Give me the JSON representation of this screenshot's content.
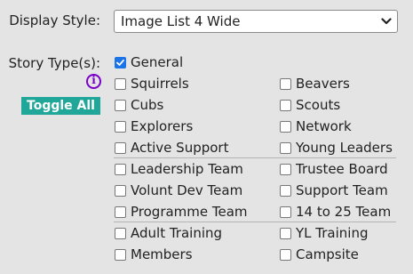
{
  "display_style": {
    "label": "Display Style:",
    "selected": "Image List 4 Wide"
  },
  "story_types": {
    "label": "Story Type(s):",
    "toggle_label": "Toggle All",
    "info_glyph": "i",
    "general": {
      "label": "General",
      "checked": true
    },
    "options": [
      {
        "label": "Squirrels",
        "checked": false
      },
      {
        "label": "Beavers",
        "checked": false
      },
      {
        "label": "Cubs",
        "checked": false
      },
      {
        "label": "Scouts",
        "checked": false
      },
      {
        "label": "Explorers",
        "checked": false
      },
      {
        "label": "Network",
        "checked": false
      },
      {
        "label": "Active Support",
        "checked": false
      },
      {
        "label": "Young Leaders",
        "checked": false
      },
      {
        "label": "Leadership Team",
        "checked": false
      },
      {
        "label": "Trustee Board",
        "checked": false
      },
      {
        "label": "Volunt Dev Team",
        "checked": false
      },
      {
        "label": "Support Team",
        "checked": false
      },
      {
        "label": "Programme Team",
        "checked": false
      },
      {
        "label": "14 to 25 Team",
        "checked": false
      },
      {
        "label": "Adult Training",
        "checked": false
      },
      {
        "label": "YL Training",
        "checked": false
      },
      {
        "label": "Members",
        "checked": false
      },
      {
        "label": "Campsite",
        "checked": false
      }
    ]
  },
  "colors": {
    "toggle_button": "#21a69a",
    "info_icon": "#7a00c8",
    "checkbox_checked": "#1a73e8"
  }
}
